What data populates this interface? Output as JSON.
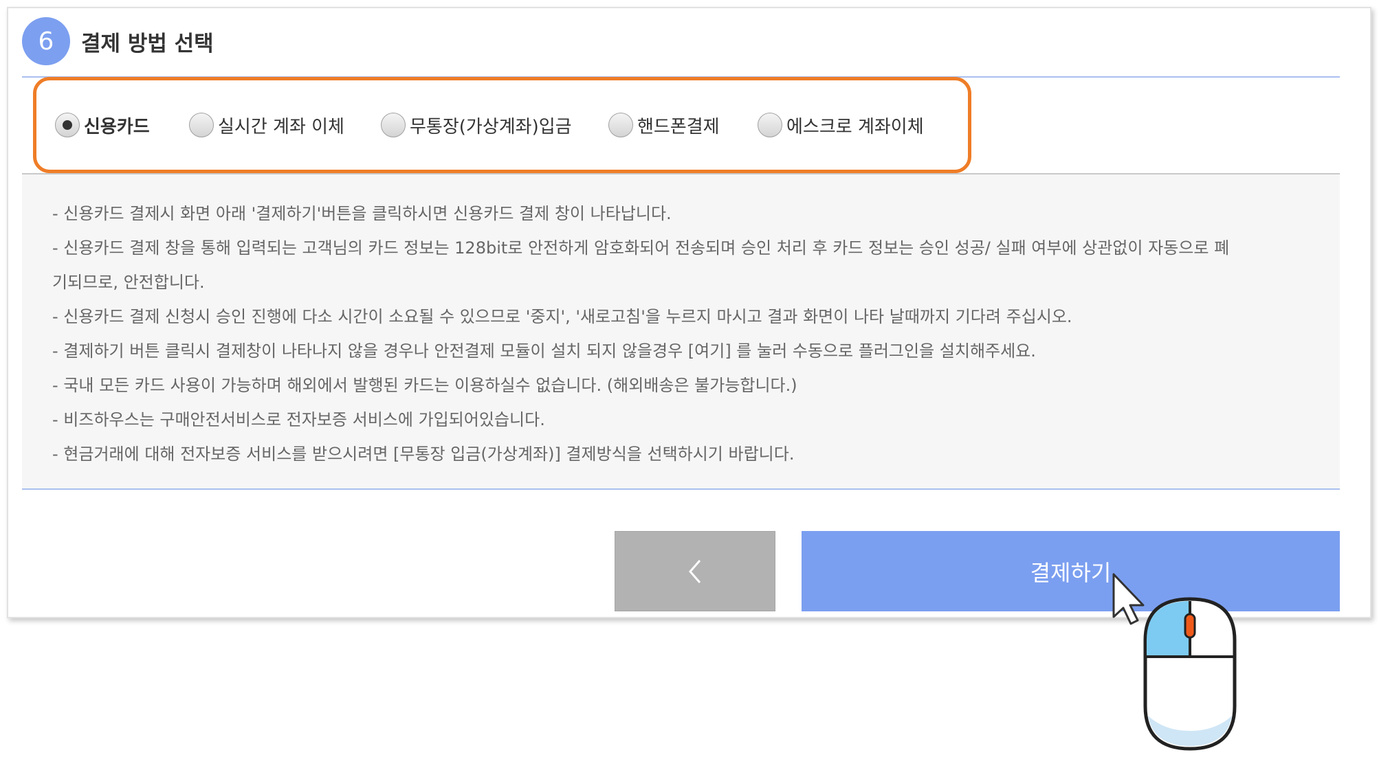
{
  "section": {
    "step_number": "6",
    "title": "결제 방법 선택"
  },
  "payment_methods": {
    "options": [
      {
        "label": "신용카드",
        "selected": true
      },
      {
        "label": "실시간 계좌 이체",
        "selected": false
      },
      {
        "label": "무통장(가상계좌)입금",
        "selected": false
      },
      {
        "label": "핸드폰결제",
        "selected": false
      },
      {
        "label": "에스크로 계좌이체",
        "selected": false
      }
    ]
  },
  "notices": [
    "- 신용카드 결제시 화면 아래 '결제하기'버튼을 클릭하시면 신용카드 결제 창이 나타납니다.",
    "- 신용카드 결제 창을 통해 입력되는 고객님의 카드 정보는 128bit로 안전하게 암호화되어 전송되며 승인 처리 후 카드 정보는 승인 성공/ 실패 여부에 상관없이 자동으로 폐",
    "기되므로, 안전합니다.",
    "- 신용카드 결제 신청시 승인 진행에 다소 시간이 소요될 수 있으므로 '중지', '새로고침'을 누르지 마시고 결과 화면이 나타 날때까지 기다려 주십시오.",
    "- 결제하기 버튼 클릭시 결제창이 나타나지 않을 경우나 안전결제 모듈이 설치 되지 않을경우 [여기] 를 눌러 수동으로 플러그인을 설치해주세요.",
    "- 국내 모든 카드 사용이 가능하며 해외에서 발행된 카드는 이용하실수 없습니다. (해외배송은 불가능합니다.)",
    "- 비즈하우스는 구매안전서비스로 전자보증 서비스에 가입되어있습니다.",
    "- 현금거래에 대해 전자보증 서비스를 받으시려면 [무통장 입금(가상계좌)] 결제방식을 선택하시기 바랍니다."
  ],
  "buttons": {
    "back_icon": "chevron-left-icon",
    "pay_label": "결제하기"
  },
  "colors": {
    "accent": "#7b9ff0",
    "highlight": "#ef7d27",
    "back_button": "#b2b2b2",
    "notice_bg": "#f6f6f6"
  }
}
